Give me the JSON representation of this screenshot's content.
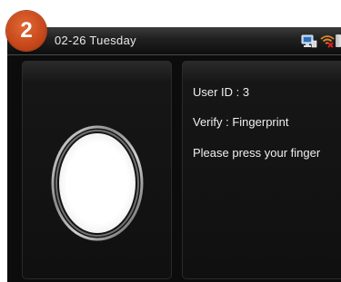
{
  "step_badge": {
    "number": "2"
  },
  "status_bar": {
    "date_text": "02-26  Tuesday",
    "icons": [
      "network-icon",
      "wifi-disconnected-icon",
      "battery-icon"
    ]
  },
  "fingerprint_area": {
    "icon": "fingerprint-oval-icon"
  },
  "info": {
    "user_id": "User ID : 3",
    "verify": "Verify : Fingerprint",
    "prompt": "Please press your finger"
  },
  "colors": {
    "badge": "#c94a1d",
    "screen_bg": "#0c0c0c",
    "text": "#f0f0f0"
  }
}
